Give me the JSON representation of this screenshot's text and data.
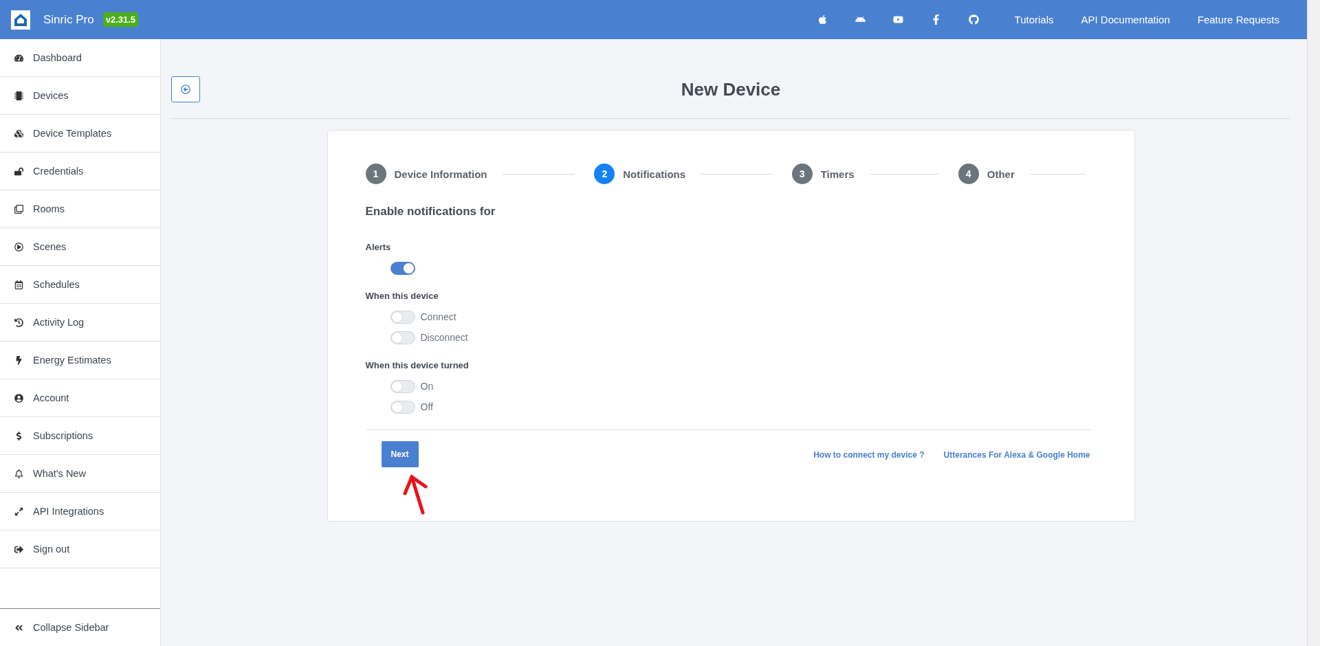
{
  "header": {
    "brand": "Sinric Pro",
    "version": "v2.31.5",
    "links": [
      "Tutorials",
      "API Documentation",
      "Feature Requests"
    ]
  },
  "sidebar": {
    "items": [
      {
        "label": "Dashboard"
      },
      {
        "label": "Devices"
      },
      {
        "label": "Device Templates"
      },
      {
        "label": "Credentials"
      },
      {
        "label": "Rooms"
      },
      {
        "label": "Scenes"
      },
      {
        "label": "Schedules"
      },
      {
        "label": "Activity Log"
      },
      {
        "label": "Energy Estimates"
      },
      {
        "label": "Account"
      },
      {
        "label": "Subscriptions"
      },
      {
        "label": "What's New"
      },
      {
        "label": "API Integrations"
      },
      {
        "label": "Sign out"
      }
    ],
    "collapse": "Collapse Sidebar"
  },
  "page": {
    "title": "New Device"
  },
  "stepper": [
    {
      "number": "1",
      "label": "Device Information",
      "selected": false
    },
    {
      "number": "2",
      "label": "Notifications",
      "selected": true
    },
    {
      "number": "3",
      "label": "Timers",
      "selected": false
    },
    {
      "number": "4",
      "label": "Other",
      "selected": false
    }
  ],
  "form": {
    "heading": "Enable notifications for",
    "groups": [
      {
        "title": "Alerts",
        "toggles": [
          {
            "on": true
          }
        ]
      },
      {
        "title": "When this device",
        "toggles": [
          {
            "label": "Connect",
            "on": false
          },
          {
            "label": "Disconnect",
            "on": false
          }
        ]
      },
      {
        "title": "When this device turned",
        "toggles": [
          {
            "label": "On",
            "on": false
          },
          {
            "label": "Off",
            "on": false
          }
        ]
      }
    ]
  },
  "footer": {
    "button": "Next",
    "links": [
      "How to connect my device ?",
      "Utterances For Alexa & Google Home"
    ]
  }
}
